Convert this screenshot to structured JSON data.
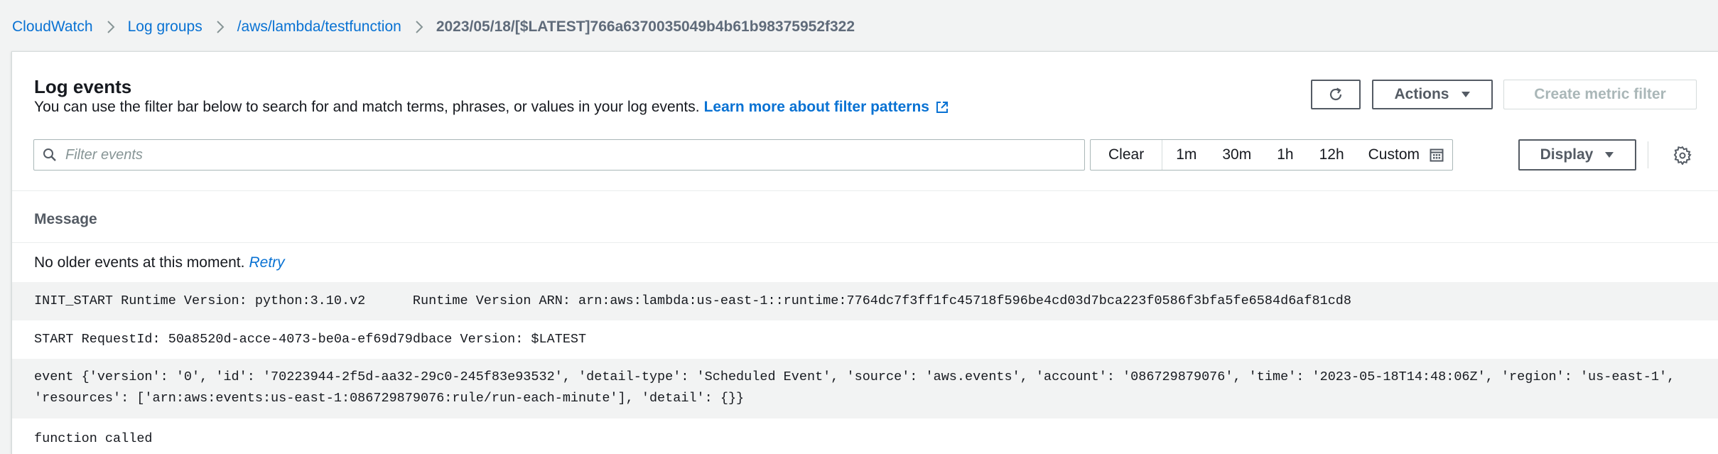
{
  "breadcrumb": {
    "items": [
      {
        "label": "CloudWatch"
      },
      {
        "label": "Log groups"
      },
      {
        "label": "/aws/lambda/testfunction"
      }
    ],
    "current": "2023/05/18/[$LATEST]766a6370035049b4b61b98375952f322"
  },
  "panel": {
    "title": "Log events",
    "description": "You can use the filter bar below to search for and match terms, phrases, or values in your log events.",
    "learn_more_label": "Learn more about filter patterns"
  },
  "buttons": {
    "refresh_icon": "refresh-icon",
    "actions_label": "Actions",
    "create_metric_filter_label": "Create metric filter",
    "display_label": "Display"
  },
  "filter": {
    "placeholder": "Filter events",
    "value": ""
  },
  "time_range": {
    "clear_label": "Clear",
    "options": [
      {
        "label": "1m"
      },
      {
        "label": "30m"
      },
      {
        "label": "1h"
      },
      {
        "label": "12h"
      }
    ],
    "custom_label": "Custom"
  },
  "table": {
    "column_header": "Message",
    "no_older_text": "No older events at this moment.",
    "retry_label": "Retry",
    "rows": [
      {
        "message": "INIT_START Runtime Version: python:3.10.v2\tRuntime Version ARN: arn:aws:lambda:us-east-1::runtime:7764dc7f3ff1fc45718f596be4cd03d7bca223f0586f3bfa5fe6584d6af81cd8"
      },
      {
        "message": "START RequestId: 50a8520d-acce-4073-be0a-ef69d79dbace Version: $LATEST"
      },
      {
        "message_line1": "event {'version': '0', 'id': '70223944-2f5d-aa32-29c0-245f83e93532', 'detail-type': 'Scheduled Event', 'source': 'aws.events', 'account': '086729879076', 'time': '2023-05-18T14:48:06Z', 'region': 'us-east-1',",
        "message_line2": "'resources': ['arn:aws:events:us-east-1:086729879076:rule/run-each-minute'], 'detail': {}}"
      },
      {
        "message": "function called"
      }
    ]
  },
  "colors": {
    "link": "#0972d3",
    "text": "#16191f",
    "muted": "#5f6b7a",
    "border": "#aab7b8",
    "row_alt": "#f2f3f3",
    "disabled": "#aab7b8"
  }
}
